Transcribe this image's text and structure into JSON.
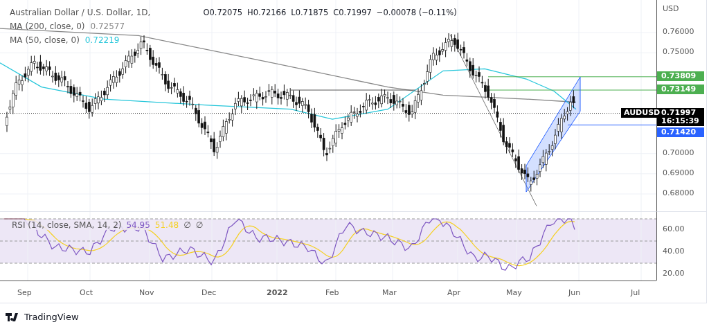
{
  "legend": {
    "title": "Australian Dollar / U.S. Dollar, 1D,",
    "ohlc": [
      {
        "key": "O",
        "value": "0.72075"
      },
      {
        "key": "H",
        "value": "0.72166"
      },
      {
        "key": "L",
        "value": "0.71875"
      },
      {
        "key": "C",
        "value": "0.71997"
      }
    ],
    "change": "−0.00078 (−0.11%)",
    "indicators": [
      {
        "label": "MA (200, close, 0)",
        "value": "0.72577",
        "color": "#888888"
      },
      {
        "label": "MA (50, close, 0)",
        "value": "0.72219",
        "color": "#26c6da"
      }
    ]
  },
  "price_axis": {
    "unit": "USD",
    "ticks": [
      "0.76000",
      "0.75000",
      "0.70000",
      "0.69000",
      "0.68000"
    ],
    "tags": [
      {
        "value": "0.73809",
        "color": "#4caf50"
      },
      {
        "value": "0.73149",
        "color": "#4caf50"
      },
      {
        "value": "0.71997",
        "sub": "16:15:39",
        "color": "#000000",
        "symbol": "AUDUSD"
      },
      {
        "value": "0.71420",
        "color": "#2962ff"
      }
    ]
  },
  "rsi": {
    "label": "RSI (14, close, SMA, 14, 2)",
    "values": [
      {
        "value": "54.95",
        "color": "#7e57c2"
      },
      {
        "value": "51.48",
        "color": "#f5d020"
      }
    ],
    "extras": [
      "∅",
      "∅"
    ],
    "ticks": [
      "60.00",
      "40.00",
      "20.00"
    ]
  },
  "time_axis": [
    {
      "label": "Sep",
      "bold": false
    },
    {
      "label": "Oct",
      "bold": false
    },
    {
      "label": "Nov",
      "bold": false
    },
    {
      "label": "Dec",
      "bold": false
    },
    {
      "label": "2022",
      "bold": true
    },
    {
      "label": "Feb",
      "bold": false
    },
    {
      "label": "Mar",
      "bold": false
    },
    {
      "label": "Apr",
      "bold": false
    },
    {
      "label": "May",
      "bold": false
    },
    {
      "label": "Jun",
      "bold": false
    },
    {
      "label": "Jul",
      "bold": false
    }
  ],
  "footer": {
    "brand": "TradingView"
  }
}
